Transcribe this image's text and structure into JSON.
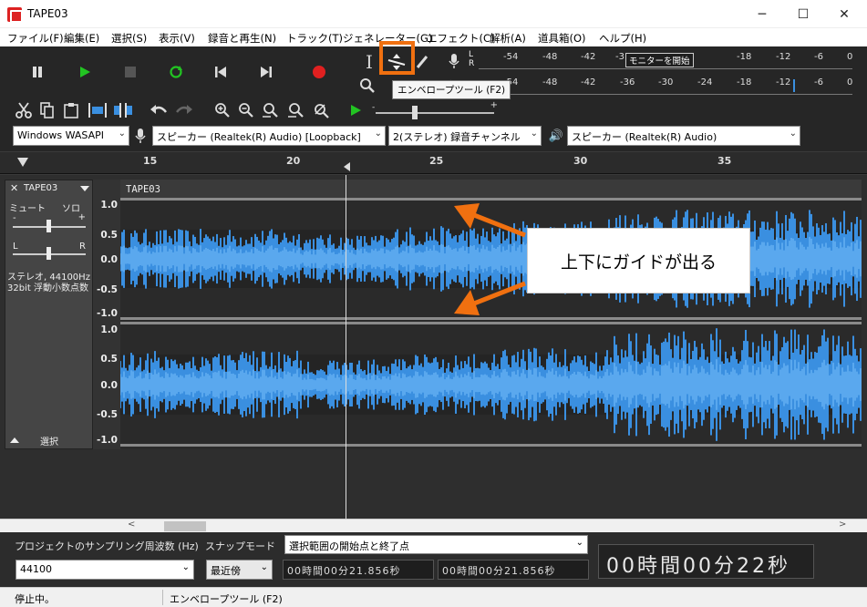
{
  "window": {
    "title": "TAPE03",
    "minimize": "─",
    "maximize": "☐",
    "close": "✕"
  },
  "menu": [
    "ファイル(F)",
    "編集(E)",
    "選択(S)",
    "表示(V)",
    "録音と再生(N)",
    "トラック(T)",
    "ジェネレーター(G)",
    "エフェクト(C)",
    "解析(A)",
    "道具箱(O)",
    "ヘルプ(H)"
  ],
  "transport": {
    "pause_icon": "pause-icon",
    "play_icon": "play-icon",
    "stop_icon": "stop-icon",
    "loop_icon": "loop-icon",
    "skip_start_icon": "skip-to-start-icon",
    "skip_end_icon": "skip-to-end-icon",
    "record_icon": "record-icon",
    "play_color": "#22c422",
    "record_color": "#e02020"
  },
  "tools": {
    "envelope_tooltip": "エンベロープツール (F2)"
  },
  "meters": {
    "record_ticks": [
      "-54",
      "-48",
      "-42",
      "-3",
      "-18",
      "-12",
      "-6",
      "0"
    ],
    "monitor_label": "モニターを開始",
    "play_ticks": [
      "-54",
      "-48",
      "-42",
      "-36",
      "-30",
      "-24",
      "-18",
      "-12",
      "-6",
      "0"
    ],
    "lr_top": "L",
    "lr_bottom": "R"
  },
  "devices": {
    "host": "Windows WASAPI",
    "input": "スピーカー (Realtek(R) Audio) [Loopback]",
    "channels": "2(ステレオ) 録音チャンネル",
    "output": "スピーカー (Realtek(R) Audio)"
  },
  "ruler": {
    "ticks": [
      "15",
      "20",
      "25",
      "30",
      "35"
    ]
  },
  "track": {
    "name": "TAPE03",
    "label": "TAPE03",
    "mute": "ミュート",
    "solo": "ソロ",
    "gain_minus": "-",
    "gain_plus": "+",
    "pan_left": "L",
    "pan_right": "R",
    "info_line1": "ステレオ, 44100Hz",
    "info_line2": "32bit 浮動小数点数",
    "select": "選択",
    "channel1_labels": [
      "1.0",
      "0.5",
      "0.0",
      "-0.5",
      "-1.0"
    ],
    "channel2_labels": [
      "1.0",
      "0.5",
      "0.0",
      "-0.5",
      "-1.0"
    ],
    "wave_color": "#3a8fe0"
  },
  "annotation": {
    "callout_text": "上下にガイドが出る",
    "arrow_color": "#f07010"
  },
  "selection_bar": {
    "rate_label": "プロジェクトのサンプリング周波数 (Hz)",
    "snap_label": "スナップモード",
    "range_mode": "選択範囲の開始点と終了点",
    "rate_value": "44100",
    "snap_value": "最近傍",
    "start_time": "00時間00分21.856秒",
    "end_time": "00時間00分21.856秒",
    "big_time": "00時間00分22秒"
  },
  "status": {
    "left": "停止中。",
    "right": "エンベロープツール (F2)"
  }
}
